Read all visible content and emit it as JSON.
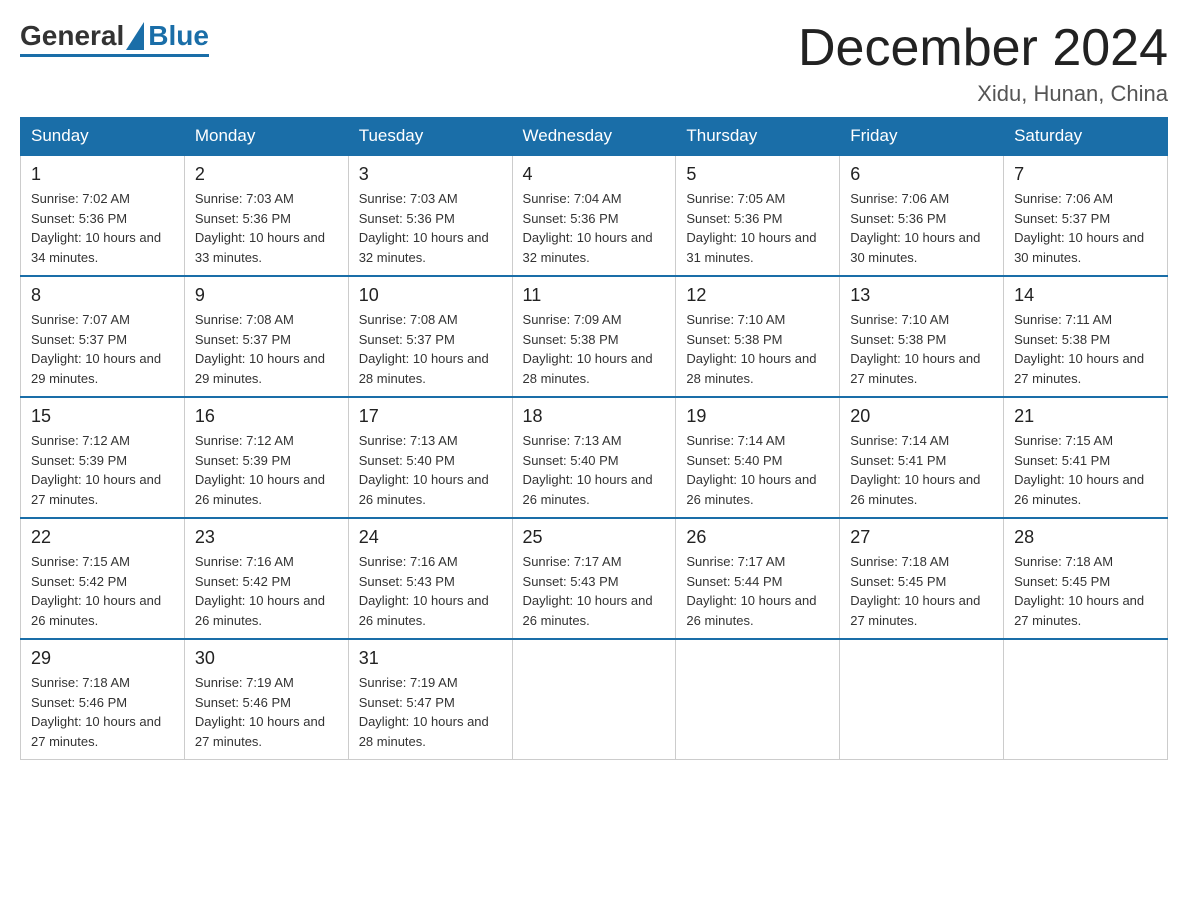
{
  "logo": {
    "general": "General",
    "blue": "Blue"
  },
  "header": {
    "month": "December 2024",
    "location": "Xidu, Hunan, China"
  },
  "days_of_week": [
    "Sunday",
    "Monday",
    "Tuesday",
    "Wednesday",
    "Thursday",
    "Friday",
    "Saturday"
  ],
  "weeks": [
    [
      {
        "day": 1,
        "sunrise": "7:02 AM",
        "sunset": "5:36 PM",
        "daylight": "10 hours and 34 minutes."
      },
      {
        "day": 2,
        "sunrise": "7:03 AM",
        "sunset": "5:36 PM",
        "daylight": "10 hours and 33 minutes."
      },
      {
        "day": 3,
        "sunrise": "7:03 AM",
        "sunset": "5:36 PM",
        "daylight": "10 hours and 32 minutes."
      },
      {
        "day": 4,
        "sunrise": "7:04 AM",
        "sunset": "5:36 PM",
        "daylight": "10 hours and 32 minutes."
      },
      {
        "day": 5,
        "sunrise": "7:05 AM",
        "sunset": "5:36 PM",
        "daylight": "10 hours and 31 minutes."
      },
      {
        "day": 6,
        "sunrise": "7:06 AM",
        "sunset": "5:36 PM",
        "daylight": "10 hours and 30 minutes."
      },
      {
        "day": 7,
        "sunrise": "7:06 AM",
        "sunset": "5:37 PM",
        "daylight": "10 hours and 30 minutes."
      }
    ],
    [
      {
        "day": 8,
        "sunrise": "7:07 AM",
        "sunset": "5:37 PM",
        "daylight": "10 hours and 29 minutes."
      },
      {
        "day": 9,
        "sunrise": "7:08 AM",
        "sunset": "5:37 PM",
        "daylight": "10 hours and 29 minutes."
      },
      {
        "day": 10,
        "sunrise": "7:08 AM",
        "sunset": "5:37 PM",
        "daylight": "10 hours and 28 minutes."
      },
      {
        "day": 11,
        "sunrise": "7:09 AM",
        "sunset": "5:38 PM",
        "daylight": "10 hours and 28 minutes."
      },
      {
        "day": 12,
        "sunrise": "7:10 AM",
        "sunset": "5:38 PM",
        "daylight": "10 hours and 28 minutes."
      },
      {
        "day": 13,
        "sunrise": "7:10 AM",
        "sunset": "5:38 PM",
        "daylight": "10 hours and 27 minutes."
      },
      {
        "day": 14,
        "sunrise": "7:11 AM",
        "sunset": "5:38 PM",
        "daylight": "10 hours and 27 minutes."
      }
    ],
    [
      {
        "day": 15,
        "sunrise": "7:12 AM",
        "sunset": "5:39 PM",
        "daylight": "10 hours and 27 minutes."
      },
      {
        "day": 16,
        "sunrise": "7:12 AM",
        "sunset": "5:39 PM",
        "daylight": "10 hours and 26 minutes."
      },
      {
        "day": 17,
        "sunrise": "7:13 AM",
        "sunset": "5:40 PM",
        "daylight": "10 hours and 26 minutes."
      },
      {
        "day": 18,
        "sunrise": "7:13 AM",
        "sunset": "5:40 PM",
        "daylight": "10 hours and 26 minutes."
      },
      {
        "day": 19,
        "sunrise": "7:14 AM",
        "sunset": "5:40 PM",
        "daylight": "10 hours and 26 minutes."
      },
      {
        "day": 20,
        "sunrise": "7:14 AM",
        "sunset": "5:41 PM",
        "daylight": "10 hours and 26 minutes."
      },
      {
        "day": 21,
        "sunrise": "7:15 AM",
        "sunset": "5:41 PM",
        "daylight": "10 hours and 26 minutes."
      }
    ],
    [
      {
        "day": 22,
        "sunrise": "7:15 AM",
        "sunset": "5:42 PM",
        "daylight": "10 hours and 26 minutes."
      },
      {
        "day": 23,
        "sunrise": "7:16 AM",
        "sunset": "5:42 PM",
        "daylight": "10 hours and 26 minutes."
      },
      {
        "day": 24,
        "sunrise": "7:16 AM",
        "sunset": "5:43 PM",
        "daylight": "10 hours and 26 minutes."
      },
      {
        "day": 25,
        "sunrise": "7:17 AM",
        "sunset": "5:43 PM",
        "daylight": "10 hours and 26 minutes."
      },
      {
        "day": 26,
        "sunrise": "7:17 AM",
        "sunset": "5:44 PM",
        "daylight": "10 hours and 26 minutes."
      },
      {
        "day": 27,
        "sunrise": "7:18 AM",
        "sunset": "5:45 PM",
        "daylight": "10 hours and 27 minutes."
      },
      {
        "day": 28,
        "sunrise": "7:18 AM",
        "sunset": "5:45 PM",
        "daylight": "10 hours and 27 minutes."
      }
    ],
    [
      {
        "day": 29,
        "sunrise": "7:18 AM",
        "sunset": "5:46 PM",
        "daylight": "10 hours and 27 minutes."
      },
      {
        "day": 30,
        "sunrise": "7:19 AM",
        "sunset": "5:46 PM",
        "daylight": "10 hours and 27 minutes."
      },
      {
        "day": 31,
        "sunrise": "7:19 AM",
        "sunset": "5:47 PM",
        "daylight": "10 hours and 28 minutes."
      },
      null,
      null,
      null,
      null
    ]
  ]
}
